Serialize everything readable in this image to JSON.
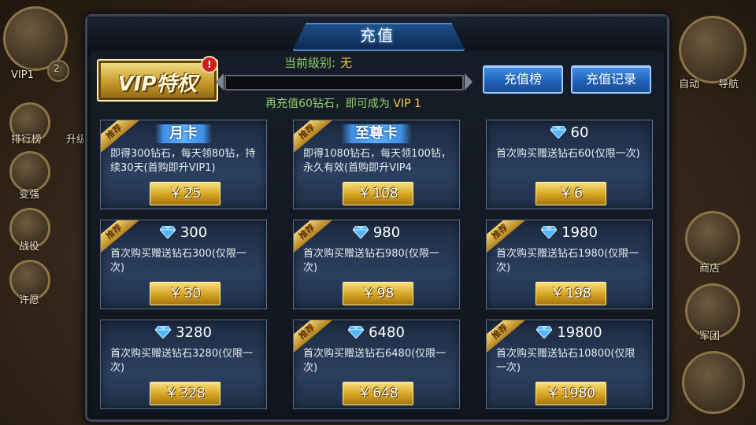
{
  "hud": {
    "player_level": "VIP1",
    "player_num": "2",
    "left_menu": [
      {
        "label": "排行榜",
        "icon": "rank-icon"
      },
      {
        "label": "变强",
        "icon": "strength-icon"
      },
      {
        "label": "战役",
        "icon": "battle-icon"
      },
      {
        "label": "许愿",
        "icon": "wish-icon"
      }
    ],
    "right_menu": [
      {
        "label": "自动",
        "icon": "auto-icon"
      },
      {
        "label": "导航",
        "icon": "navigate-icon"
      },
      {
        "label": "商店",
        "icon": "shop-icon"
      },
      {
        "label": "军团",
        "icon": "legion-icon"
      }
    ],
    "partial_left": "升级"
  },
  "panel": {
    "title": "充值",
    "vip_badge": "VIP特权",
    "alert_mark": "!",
    "current_level_label": "当前级别:",
    "current_level_value": "无",
    "progress": 0,
    "hint_prefix": "再充值60钻石，即可成为",
    "hint_vip": "VIP 1",
    "buttons": {
      "ranking": "充值榜",
      "history": "充值记录"
    }
  },
  "currency_symbol": "￥",
  "ribbon_label": "推荐",
  "cards": [
    {
      "kind": "banner",
      "title": "月卡",
      "recommended": true,
      "desc": "即得300钻石，每天领80钻，持续30天(首购即升VIP1)",
      "price": "25"
    },
    {
      "kind": "banner",
      "title": "至尊卡",
      "recommended": true,
      "desc": "即得1080钻石，每天领100钻，永久有效(首购即升VIP4",
      "price": "108"
    },
    {
      "kind": "gem",
      "title": "60",
      "recommended": false,
      "desc": "首次购买赠送钻石60(仅限一次)",
      "price": "6"
    },
    {
      "kind": "gem",
      "title": "300",
      "recommended": true,
      "desc": "首次购买赠送钻石300(仅限一次)",
      "price": "30"
    },
    {
      "kind": "gem",
      "title": "980",
      "recommended": true,
      "desc": "首次购买赠送钻石980(仅限一次)",
      "price": "98"
    },
    {
      "kind": "gem",
      "title": "1980",
      "recommended": true,
      "desc": "首次购买赠送钻石1980(仅限一次)",
      "price": "198"
    },
    {
      "kind": "gem",
      "title": "3280",
      "recommended": false,
      "desc": "首次购买赠送钻石3280(仅限一次)",
      "price": "328"
    },
    {
      "kind": "gem",
      "title": "6480",
      "recommended": true,
      "desc": "首次购买赠送钻石6480(仅限一次)",
      "price": "648"
    },
    {
      "kind": "gem",
      "title": "19800",
      "recommended": true,
      "desc": "首次购买赠送钻石10800(仅限一次)",
      "price": "1980"
    }
  ],
  "colors": {
    "accent_blue": "#3f8fe6",
    "gold": "#d6a321",
    "green_text": "#8fd46a",
    "yellow_text": "#f3c84a"
  }
}
